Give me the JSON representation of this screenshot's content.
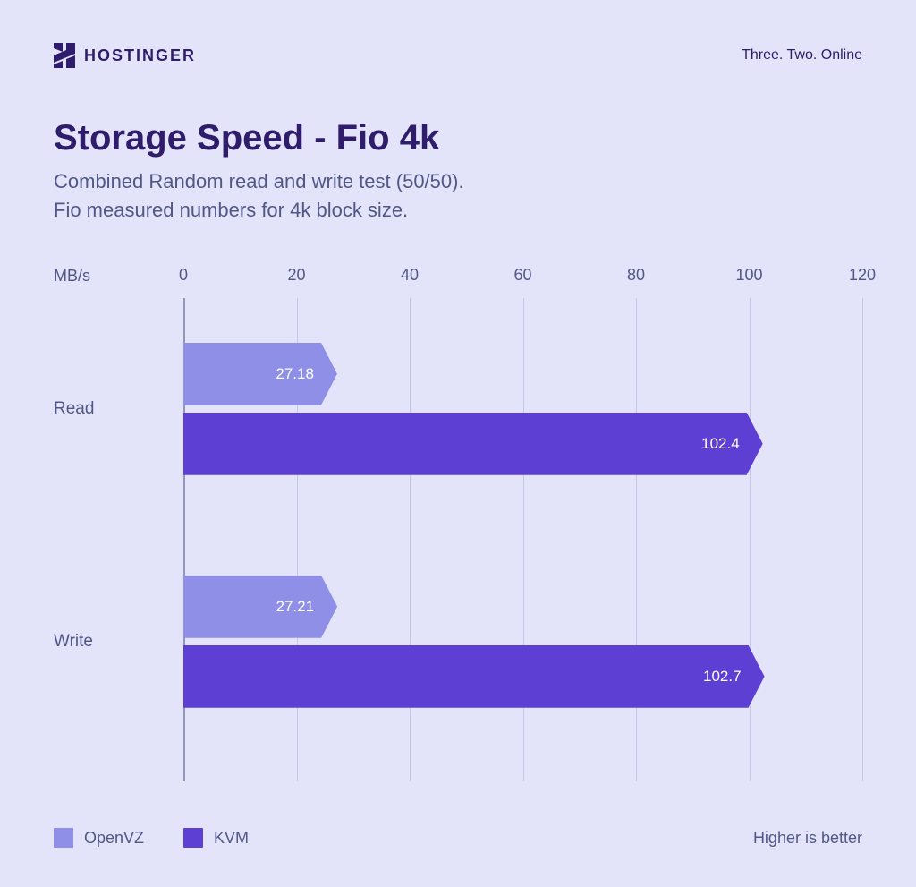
{
  "brand": {
    "name": "HOSTINGER",
    "tagline": "Three. Two. Online"
  },
  "title": "Storage Speed - Fio 4k",
  "subtitle": "Combined Random read and write test (50/50).\nFio measured numbers for 4k block size.",
  "axis_label": "MB/s",
  "ticks": [
    0,
    20,
    40,
    60,
    80,
    100,
    120
  ],
  "footer_hint": "Higher is better",
  "legend": {
    "openvz": "OpenVZ",
    "kvm": "KVM"
  },
  "chart_data": {
    "type": "bar",
    "orientation": "horizontal",
    "xlabel": "MB/s",
    "ylabel": "",
    "xlim": [
      0,
      120
    ],
    "categories": [
      "Read",
      "Write"
    ],
    "series": [
      {
        "name": "OpenVZ",
        "color": "#8f8fe8",
        "values": [
          27.18,
          27.21
        ]
      },
      {
        "name": "KVM",
        "color": "#5d3fd3",
        "values": [
          102.4,
          102.7
        ]
      }
    ],
    "note": "Higher is better"
  }
}
